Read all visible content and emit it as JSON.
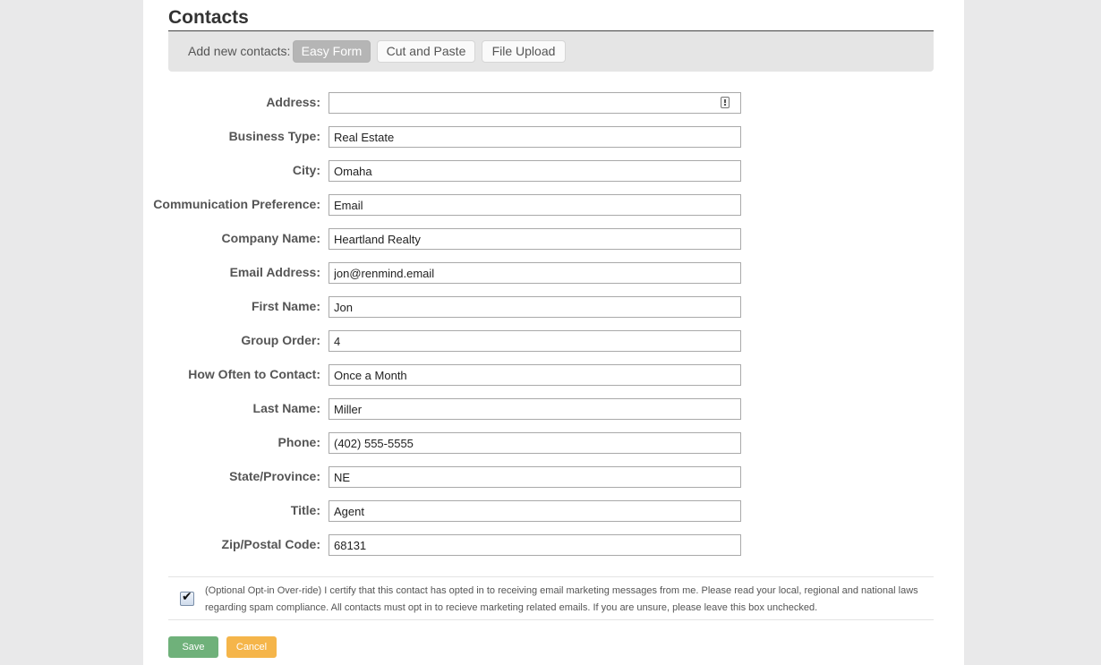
{
  "page": {
    "title": "Contacts"
  },
  "toolbar": {
    "label": "Add new contacts:",
    "tabs": [
      {
        "label": "Easy Form",
        "active": true
      },
      {
        "label": "Cut and Paste",
        "active": false
      },
      {
        "label": "File Upload",
        "active": false
      }
    ]
  },
  "form": {
    "fields": [
      {
        "label": "Address:",
        "value": ""
      },
      {
        "label": "Business Type:",
        "value": "Real Estate"
      },
      {
        "label": "City:",
        "value": "Omaha"
      },
      {
        "label": "Communication Preference:",
        "value": "Email"
      },
      {
        "label": "Company Name:",
        "value": "Heartland Realty"
      },
      {
        "label": "Email Address:",
        "value": "jon@renmind.email"
      },
      {
        "label": "First Name:",
        "value": "Jon"
      },
      {
        "label": "Group Order:",
        "value": "4"
      },
      {
        "label": "How Often to Contact:",
        "value": "Once a Month"
      },
      {
        "label": "Last Name:",
        "value": "Miller"
      },
      {
        "label": "Phone:",
        "value": "(402) 555-5555"
      },
      {
        "label": "State/Province:",
        "value": "NE"
      },
      {
        "label": "Title:",
        "value": "Agent"
      },
      {
        "label": "Zip/Postal Code:",
        "value": "68131"
      }
    ]
  },
  "optin": {
    "checked": true,
    "check_glyph": "✔",
    "text": "(Optional Opt-in Over-ride) I certify that this contact has opted in to receiving email marketing messages from me. Please read your local, regional and national laws regarding spam compliance. All contacts must opt in to recieve marketing related emails. If you are unsure, please leave this box unchecked."
  },
  "actions": {
    "save_label": "Save",
    "cancel_label": "Cancel"
  },
  "colors": {
    "save": "#6fb17a",
    "cancel": "#f5b54a",
    "active_tab": "#b5b5b5"
  }
}
